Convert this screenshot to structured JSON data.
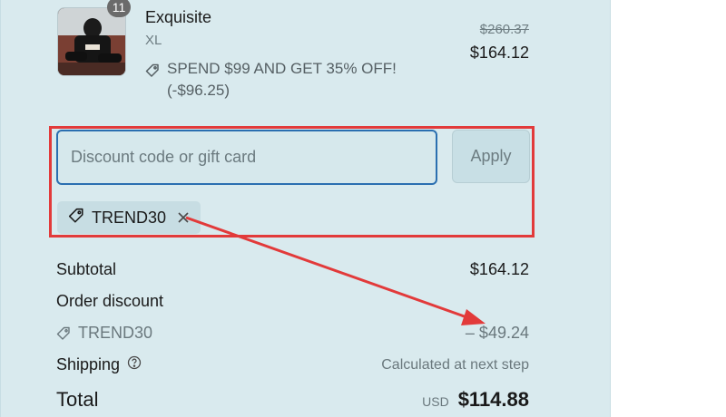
{
  "product": {
    "quantity": "11",
    "name": "Exquisite",
    "variant": "XL",
    "promo_text": "SPEND $99 AND GET 35% OFF! (-$96.25)",
    "original_price": "$260.37",
    "price": "$164.12"
  },
  "discount": {
    "placeholder": "Discount code or gift card",
    "value": "",
    "apply_label": "Apply",
    "applied_code": "TREND30"
  },
  "summary": {
    "subtotal_label": "Subtotal",
    "subtotal_value": "$164.12",
    "order_discount_label": "Order discount",
    "discount_code": "TREND30",
    "discount_value": "– $49.24",
    "shipping_label": "Shipping",
    "shipping_value": "Calculated at next step",
    "total_label": "Total",
    "currency": "USD",
    "total_value": "$114.88"
  },
  "colors": {
    "panel_bg": "#d9eaee",
    "annotation_red": "#e23a3a",
    "input_focus_border": "#2b6fb0"
  },
  "icons": {
    "tag": "tag-icon",
    "close": "close-icon",
    "help": "question-circle-icon"
  }
}
